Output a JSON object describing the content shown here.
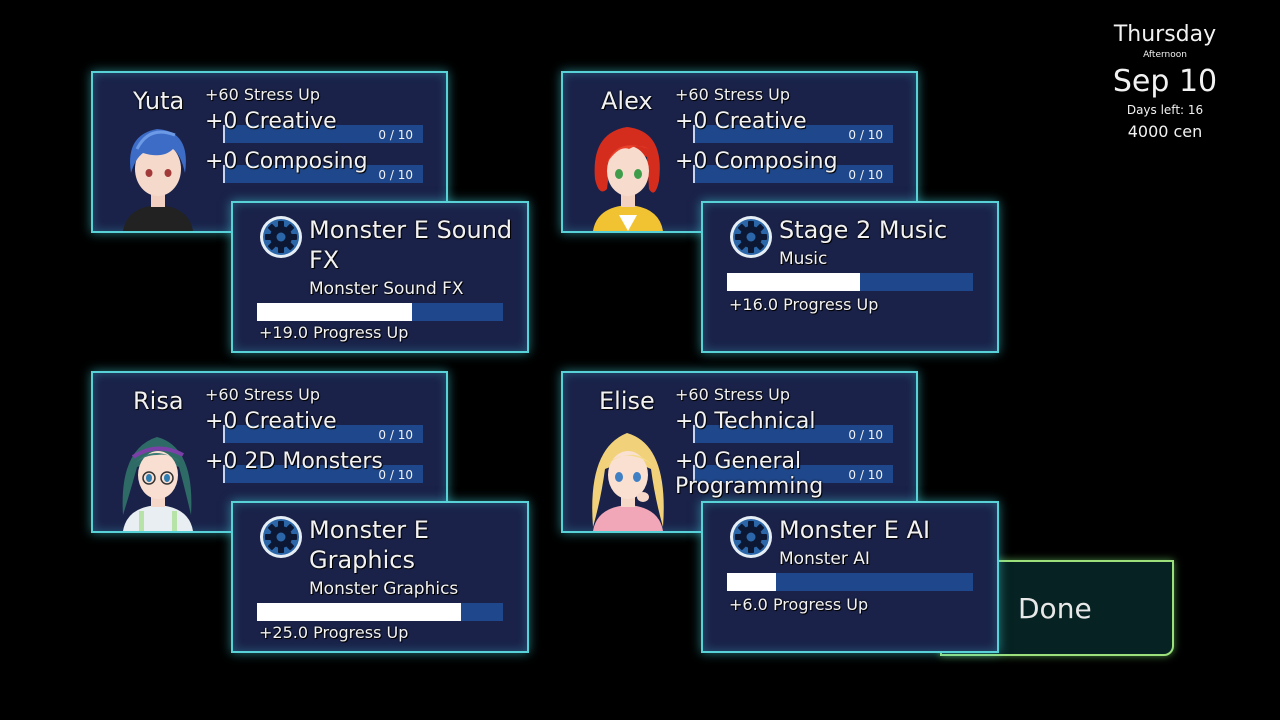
{
  "calendar": {
    "weekday": "Thursday",
    "time_of_day": "Afternoon",
    "date": "Sep 10",
    "days_left": "Days left: 16",
    "money": "4000 cen"
  },
  "characters": [
    {
      "name": "Yuta",
      "stress": "+60 Stress Up",
      "stats": [
        {
          "label": "+0 Creative",
          "count": "0 / 10"
        },
        {
          "label": "+0 Composing",
          "count": "0 / 10"
        }
      ]
    },
    {
      "name": "Alex",
      "stress": "+60 Stress Up",
      "stats": [
        {
          "label": "+0 Creative",
          "count": "0 / 10"
        },
        {
          "label": "+0 Composing",
          "count": "0 / 10"
        }
      ]
    },
    {
      "name": "Risa",
      "stress": "+60 Stress Up",
      "stats": [
        {
          "label": "+0 Creative",
          "count": "0 / 10"
        },
        {
          "label": "+0 2D Monsters",
          "count": "0 / 10"
        }
      ]
    },
    {
      "name": "Elise",
      "stress": "+60 Stress Up",
      "stats": [
        {
          "label": "+0 Technical",
          "count": "0 / 10"
        },
        {
          "label": "+0 General Programming",
          "count": "0 / 10"
        }
      ]
    }
  ],
  "tasks": [
    {
      "title": "Monster E Sound FX",
      "subtitle": "Monster Sound FX",
      "progress": 0.63,
      "progress_text": "+19.0 Progress Up",
      "icon": "gear-icon"
    },
    {
      "title": "Stage 2 Music",
      "subtitle": "Music",
      "progress": 0.54,
      "progress_text": "+16.0 Progress Up",
      "icon": "gear-icon"
    },
    {
      "title": "Monster E Graphics",
      "subtitle": "Monster Graphics",
      "progress": 0.83,
      "progress_text": "+25.0 Progress Up",
      "icon": "gear-icon"
    },
    {
      "title": "Monster E AI",
      "subtitle": "Monster AI",
      "progress": 0.2,
      "progress_text": "+6.0 Progress Up",
      "icon": "gear-icon"
    }
  ],
  "done_button": {
    "label": "Done"
  },
  "colors": {
    "panel_bg": "#1a2249",
    "panel_border": "#59d2d7",
    "bar_bg": "#1f478b",
    "bar_fill": "#ffffff",
    "done_border": "#9be07a"
  }
}
